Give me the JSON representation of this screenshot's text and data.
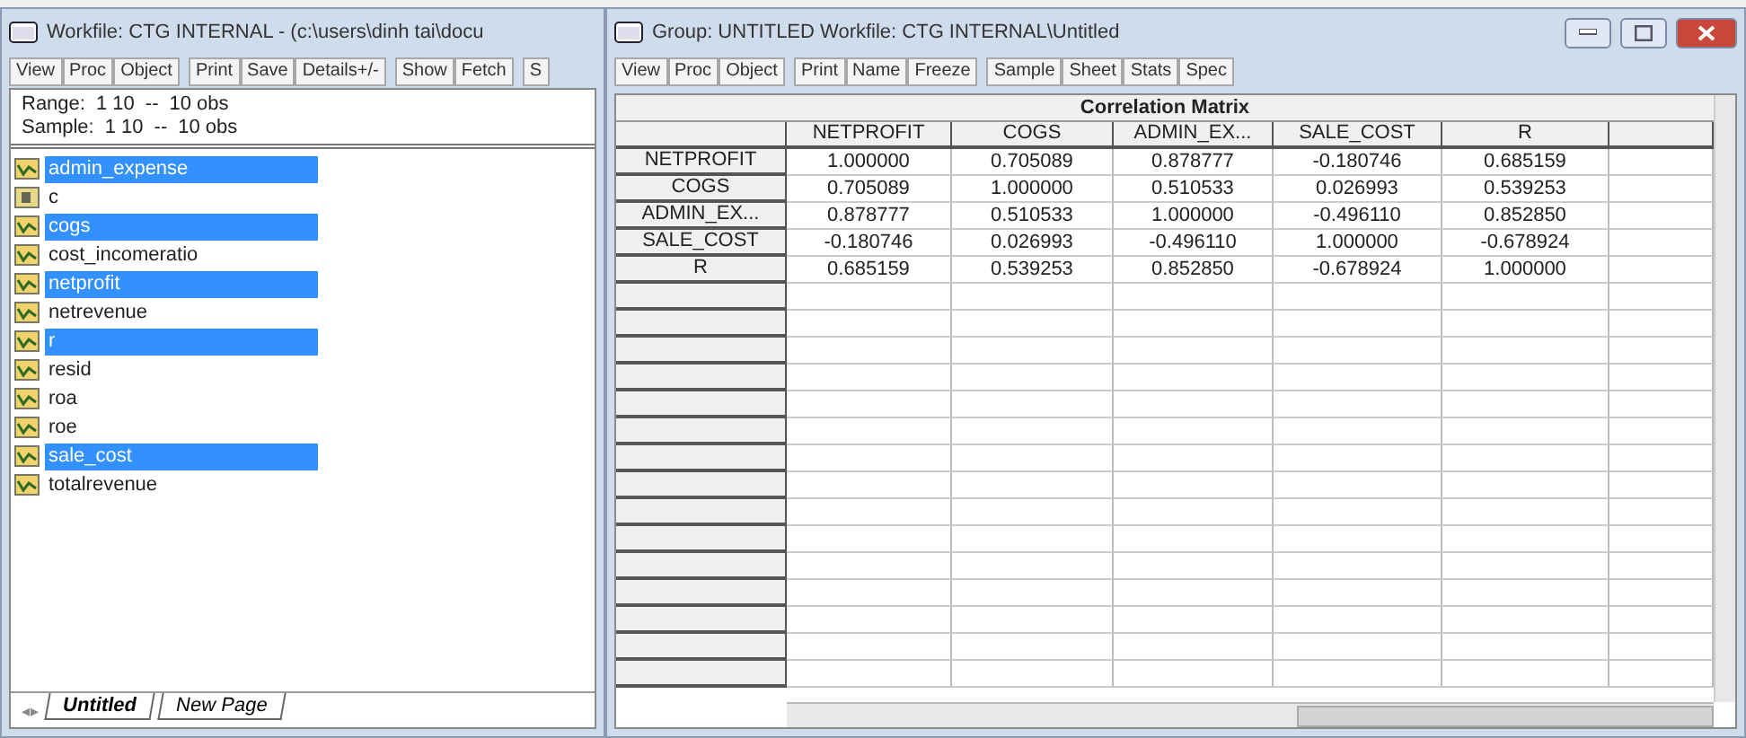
{
  "workfile_window": {
    "title": "Workfile: CTG INTERNAL - (c:\\users\\dinh tai\\docu",
    "toolbar": [
      "View",
      "Proc",
      "Object",
      "Print",
      "Save",
      "Details+/-",
      "Show",
      "Fetch",
      "S"
    ],
    "range": {
      "label": "Range:",
      "value": "1 10",
      "dash": "--",
      "obs": "10 obs"
    },
    "sample": {
      "label": "Sample:",
      "value": "1 10",
      "dash": "--",
      "obs": "10 obs"
    },
    "objects": [
      {
        "name": "admin_expense",
        "kind": "series",
        "selected": true
      },
      {
        "name": "c",
        "kind": "coef",
        "selected": false
      },
      {
        "name": "cogs",
        "kind": "series",
        "selected": true
      },
      {
        "name": "cost_incomeratio",
        "kind": "series",
        "selected": false
      },
      {
        "name": "netprofit",
        "kind": "series",
        "selected": true
      },
      {
        "name": "netrevenue",
        "kind": "series",
        "selected": false
      },
      {
        "name": "r",
        "kind": "series",
        "selected": true
      },
      {
        "name": "resid",
        "kind": "series",
        "selected": false
      },
      {
        "name": "roa",
        "kind": "series",
        "selected": false
      },
      {
        "name": "roe",
        "kind": "series",
        "selected": false
      },
      {
        "name": "sale_cost",
        "kind": "series",
        "selected": true
      },
      {
        "name": "totalrevenue",
        "kind": "series",
        "selected": false
      }
    ],
    "tab_arrows": "◂▸",
    "page_tabs": [
      {
        "label": "Untitled",
        "selected": true
      },
      {
        "label": "New Page",
        "selected": false
      }
    ]
  },
  "group_window": {
    "title": "Group: UNTITLED   Workfile: CTG INTERNAL\\Untitled",
    "toolbar": [
      "View",
      "Proc",
      "Object",
      "Print",
      "Name",
      "Freeze",
      "Sample",
      "Sheet",
      "Stats",
      "Spec"
    ],
    "table": {
      "title": "Correlation Matrix",
      "columns": [
        "NETPROFIT",
        "COGS",
        "ADMIN_EX...",
        "SALE_COST",
        "R"
      ],
      "rows": [
        {
          "label": "NETPROFIT",
          "cells": [
            "1.000000",
            "0.705089",
            "0.878777",
            "-0.180746",
            "0.685159"
          ]
        },
        {
          "label": "COGS",
          "cells": [
            "0.705089",
            "1.000000",
            "0.510533",
            "0.026993",
            "0.539253"
          ]
        },
        {
          "label": "ADMIN_EX...",
          "cells": [
            "0.878777",
            "0.510533",
            "1.000000",
            "-0.496110",
            "0.852850"
          ]
        },
        {
          "label": "SALE_COST",
          "cells": [
            "-0.180746",
            "0.026993",
            "-0.496110",
            "1.000000",
            "-0.678924"
          ]
        },
        {
          "label": "R",
          "cells": [
            "0.685159",
            "0.539253",
            "0.852850",
            "-0.678924",
            "1.000000"
          ]
        }
      ]
    }
  }
}
